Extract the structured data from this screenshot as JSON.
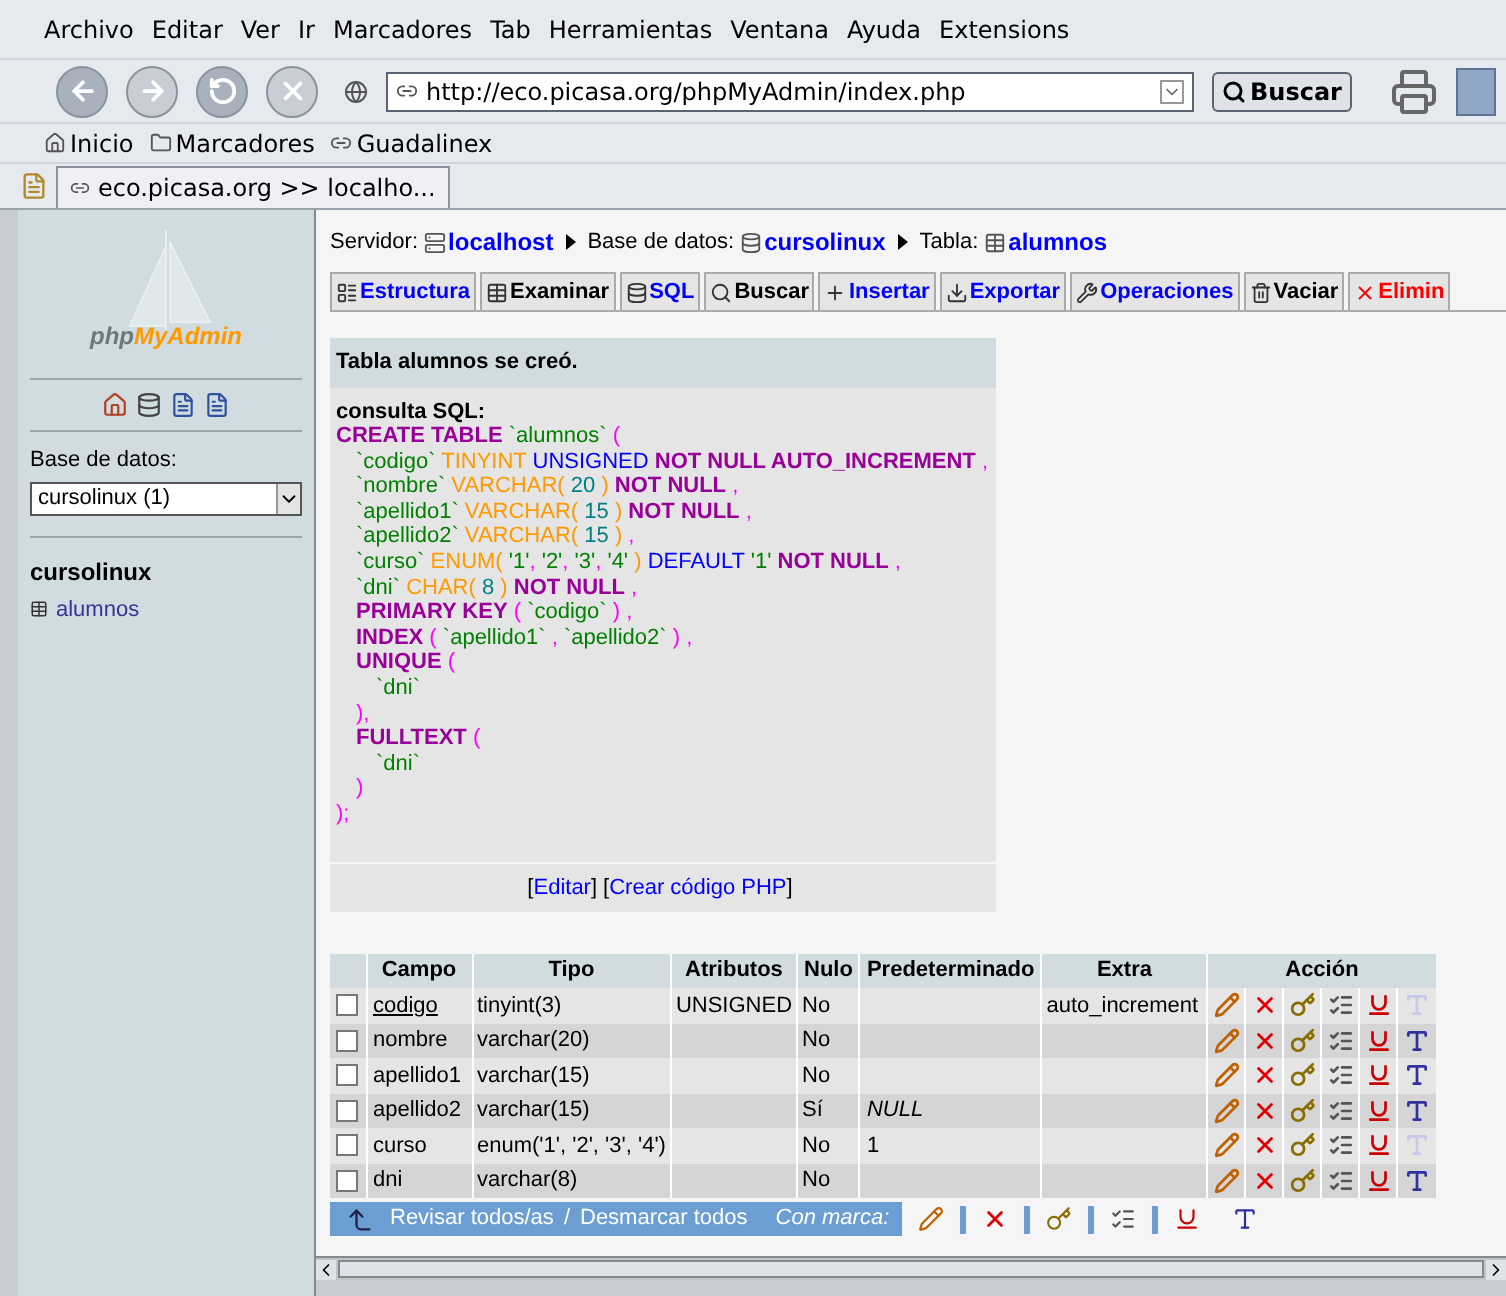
{
  "menu": [
    "Archivo",
    "Editar",
    "Ver",
    "Ir",
    "Marcadores",
    "Tab",
    "Herramientas",
    "Ventana",
    "Ayuda",
    "Extensions"
  ],
  "address_bar": {
    "url": "http://eco.picasa.org/phpMyAdmin/index.php",
    "search_button": "Buscar"
  },
  "bookmarks": [
    {
      "kind": "home",
      "label": "Inicio"
    },
    {
      "kind": "folder",
      "label": "Marcadores"
    },
    {
      "kind": "link",
      "label": "Guadalinex"
    }
  ],
  "browser_tabs": [
    {
      "label": "eco.picasa.org >> localho...",
      "selected": true
    }
  ],
  "sidebar": {
    "logo": {
      "part1": "php",
      "part2": "MyAdmin"
    },
    "database_label": "Base de datos:",
    "database_select": "cursolinux (1)",
    "database_name": "cursolinux",
    "tables": [
      {
        "label": "alumnos"
      }
    ]
  },
  "breadcrumb": [
    {
      "label": "Servidor:",
      "kind": "label"
    },
    {
      "label": "localhost",
      "kind": "server"
    },
    {
      "label": "Base de datos:",
      "kind": "label"
    },
    {
      "label": "cursolinux",
      "kind": "database"
    },
    {
      "label": "Tabla:",
      "kind": "label"
    },
    {
      "label": "alumnos",
      "kind": "table"
    }
  ],
  "tabs": [
    {
      "label": "Estructura",
      "kind": "link"
    },
    {
      "label": "Examinar",
      "kind": "inactive"
    },
    {
      "label": "SQL",
      "kind": "link"
    },
    {
      "label": "Buscar",
      "kind": "inactive"
    },
    {
      "label": "Insertar",
      "kind": "link"
    },
    {
      "label": "Exportar",
      "kind": "link"
    },
    {
      "label": "Operaciones",
      "kind": "link"
    },
    {
      "label": "Vaciar",
      "kind": "inactive"
    },
    {
      "label": "Elimin",
      "kind": "danger"
    }
  ],
  "message": {
    "title": "Tabla alumnos se creó.",
    "query_label": "consulta SQL:",
    "sql_lines": [
      {
        "kind": "statement",
        "tokens": [
          {
            "kind": "keyword",
            "text": "CREATE TABLE"
          },
          {
            "kind": "string",
            "text": " `alumnos`"
          },
          {
            "kind": "punct",
            "text": " ("
          }
        ]
      },
      {
        "kind": "member",
        "tokens": [
          {
            "kind": "string",
            "text": "`codigo`"
          },
          {
            "kind": "type",
            "text": " TINYINT"
          },
          {
            "kind": "attr",
            "text": " UNSIGNED"
          },
          {
            "kind": "keyword",
            "text": " NOT NULL AUTO_INCREMENT"
          },
          {
            "kind": "punct",
            "text": " ,"
          }
        ]
      },
      {
        "kind": "member",
        "tokens": [
          {
            "kind": "string",
            "text": "`nombre`"
          },
          {
            "kind": "type",
            "text": " VARCHAR("
          },
          {
            "kind": "number",
            "text": " 20 "
          },
          {
            "kind": "type",
            "text": ")"
          },
          {
            "kind": "keyword",
            "text": " NOT NULL"
          },
          {
            "kind": "punct",
            "text": " ,"
          }
        ]
      },
      {
        "kind": "member",
        "tokens": [
          {
            "kind": "string",
            "text": "`apellido1`"
          },
          {
            "kind": "type",
            "text": " VARCHAR("
          },
          {
            "kind": "number",
            "text": " 15 "
          },
          {
            "kind": "type",
            "text": ")"
          },
          {
            "kind": "keyword",
            "text": " NOT NULL"
          },
          {
            "kind": "punct",
            "text": " ,"
          }
        ]
      },
      {
        "kind": "member",
        "tokens": [
          {
            "kind": "string",
            "text": "`apellido2`"
          },
          {
            "kind": "type",
            "text": " VARCHAR("
          },
          {
            "kind": "number",
            "text": " 15 "
          },
          {
            "kind": "type",
            "text": ")"
          },
          {
            "kind": "punct",
            "text": " ,"
          }
        ]
      },
      {
        "kind": "member",
        "tokens": [
          {
            "kind": "string",
            "text": "`curso`"
          },
          {
            "kind": "type",
            "text": " ENUM("
          },
          {
            "kind": "string",
            "text": " '1'"
          },
          {
            "kind": "punct",
            "text": ","
          },
          {
            "kind": "string",
            "text": " '2'"
          },
          {
            "kind": "punct",
            "text": ","
          },
          {
            "kind": "string",
            "text": " '3'"
          },
          {
            "kind": "punct",
            "text": ","
          },
          {
            "kind": "string",
            "text": " '4' "
          },
          {
            "kind": "type",
            "text": ")"
          },
          {
            "kind": "attr",
            "text": " DEFAULT"
          },
          {
            "kind": "string",
            "text": " '1'"
          },
          {
            "kind": "keyword",
            "text": " NOT NULL"
          },
          {
            "kind": "punct",
            "text": " ,"
          }
        ]
      },
      {
        "kind": "member",
        "tokens": [
          {
            "kind": "string",
            "text": "`dni`"
          },
          {
            "kind": "type",
            "text": " CHAR("
          },
          {
            "kind": "number",
            "text": " 8 "
          },
          {
            "kind": "type",
            "text": ")"
          },
          {
            "kind": "keyword",
            "text": " NOT NULL"
          },
          {
            "kind": "punct",
            "text": " ,"
          }
        ]
      },
      {
        "kind": "member",
        "tokens": [
          {
            "kind": "keyword",
            "text": "PRIMARY KEY"
          },
          {
            "kind": "punct",
            "text": " ("
          },
          {
            "kind": "string",
            "text": " `codigo` "
          },
          {
            "kind": "punct",
            "text": ") ,"
          }
        ]
      },
      {
        "kind": "member",
        "tokens": [
          {
            "kind": "keyword",
            "text": "INDEX"
          },
          {
            "kind": "punct",
            "text": " ("
          },
          {
            "kind": "string",
            "text": " `apellido1`"
          },
          {
            "kind": "punct",
            "text": " ,"
          },
          {
            "kind": "string",
            "text": " `apellido2` "
          },
          {
            "kind": "punct",
            "text": ") ,"
          }
        ]
      },
      {
        "kind": "member",
        "tokens": [
          {
            "kind": "keyword",
            "text": "UNIQUE"
          },
          {
            "kind": "punct",
            "text": " ("
          }
        ]
      },
      {
        "kind": "nested",
        "tokens": [
          {
            "kind": "string",
            "text": "`dni`"
          }
        ]
      },
      {
        "kind": "member",
        "tokens": [
          {
            "kind": "punct",
            "text": "),"
          }
        ]
      },
      {
        "kind": "member",
        "tokens": [
          {
            "kind": "keyword",
            "text": "FULLTEXT"
          },
          {
            "kind": "punct",
            "text": " ("
          }
        ]
      },
      {
        "kind": "nested",
        "tokens": [
          {
            "kind": "string",
            "text": "`dni`"
          }
        ]
      },
      {
        "kind": "member",
        "tokens": [
          {
            "kind": "punct",
            "text": ")"
          }
        ]
      },
      {
        "kind": "statement",
        "tokens": [
          {
            "kind": "punct",
            "text": ");"
          }
        ]
      }
    ],
    "links": [
      {
        "open": "[",
        "label": "Editar",
        "close": "]"
      },
      {
        "open": "[",
        "label": "Crear código PHP",
        "close": "]"
      }
    ]
  },
  "table": {
    "columns": [
      "Campo",
      "Tipo",
      "Atributos",
      "Nulo",
      "Predeterminado",
      "Extra",
      "Acción"
    ],
    "rows": [
      {
        "checked": false,
        "field": "codigo",
        "primary": true,
        "type": "tinyint(3)",
        "attributes": "UNSIGNED",
        "null": "No",
        "extra": "auto_increment",
        "fulltext_disabled": true
      },
      {
        "checked": false,
        "field": "nombre",
        "primary": false,
        "type": "varchar(20)",
        "null": "No",
        "fulltext_disabled": false
      },
      {
        "checked": false,
        "field": "apellido1",
        "primary": false,
        "type": "varchar(15)",
        "null": "No",
        "fulltext_disabled": false
      },
      {
        "checked": false,
        "field": "apellido2",
        "primary": false,
        "type": "varchar(15)",
        "null": "Sí",
        "default": "NULL",
        "default_null": true,
        "fulltext_disabled": false
      },
      {
        "checked": false,
        "field": "curso",
        "primary": false,
        "type": "enum('1', '2', '3', '4')",
        "null": "No",
        "default": "1",
        "default_null": false,
        "fulltext_disabled": true
      },
      {
        "checked": false,
        "field": "dni",
        "primary": false,
        "type": "varchar(8)",
        "null": "No",
        "fulltext_disabled": false
      }
    ],
    "check_all": "Revisar todos/as",
    "separator": "/",
    "uncheck_all": "Desmarcar todos",
    "with_selected": "Con marca:"
  }
}
